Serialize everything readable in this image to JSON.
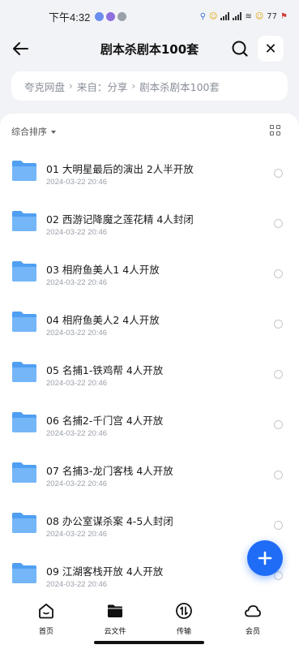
{
  "status_bar": {
    "time": "下午4:32",
    "battery": "77"
  },
  "header": {
    "title": "剧本杀剧本100套",
    "close_label": "✕"
  },
  "breadcrumb": {
    "items": [
      "夸克网盘",
      "来自：分享",
      "剧本杀剧本100套"
    ],
    "separator": "›"
  },
  "toolbar": {
    "sort_label": "综合排序"
  },
  "files": [
    {
      "name": "01 大明星最后的演出 2人半开放",
      "date": "2024-03-22 20:46"
    },
    {
      "name": "02 西游记降魔之莲花精 4人封闭",
      "date": "2024-03-22 20:46"
    },
    {
      "name": "03 相府鱼美人1 4人开放",
      "date": "2024-03-22 20:46"
    },
    {
      "name": "04 相府鱼美人2 4人开放",
      "date": "2024-03-22 20:46"
    },
    {
      "name": "05 名捕1-铁鸡帮 4人开放",
      "date": "2024-03-22 20:46"
    },
    {
      "name": "06 名捕2-千门宫 4人开放",
      "date": "2024-03-22 20:46"
    },
    {
      "name": "07 名捕3-龙门客栈 4人开放",
      "date": "2024-03-22 20:46"
    },
    {
      "name": "08 办公室谋杀案 4-5人封闭",
      "date": "2024-03-22 20:46"
    },
    {
      "name": "09 江湖客栈开放 4人开放",
      "date": "2024-03-22 20:46"
    }
  ],
  "bottom_nav": [
    {
      "label": "首页",
      "icon": "home-icon"
    },
    {
      "label": "云文件",
      "icon": "folder-icon"
    },
    {
      "label": "传输",
      "icon": "transfer-icon"
    },
    {
      "label": "会员",
      "icon": "cloud-icon"
    }
  ],
  "colors": {
    "accent": "#1f6cf7",
    "folder": "#5aa8f5",
    "background": "#f2f3f6"
  }
}
